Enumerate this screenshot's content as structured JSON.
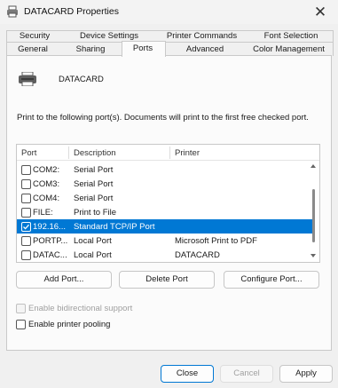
{
  "window": {
    "title": "DATACARD Properties",
    "close_glyph": "✕"
  },
  "tabs": {
    "row1": [
      "Security",
      "Device Settings",
      "Printer Commands",
      "Font Selection"
    ],
    "row2": [
      "General",
      "Sharing",
      "Ports",
      "Advanced",
      "Color Management"
    ],
    "active": "Ports"
  },
  "printer": {
    "name": "DATACARD",
    "icon": "printer-icon"
  },
  "instructions": "Print to the following port(s). Documents will print to the first free checked port.",
  "ports_table": {
    "columns": [
      "Port",
      "Description",
      "Printer"
    ],
    "rows": [
      {
        "port": "COM2:",
        "description": "Serial Port",
        "printer": "",
        "checked": false,
        "selected": false
      },
      {
        "port": "COM3:",
        "description": "Serial Port",
        "printer": "",
        "checked": false,
        "selected": false
      },
      {
        "port": "COM4:",
        "description": "Serial Port",
        "printer": "",
        "checked": false,
        "selected": false
      },
      {
        "port": "FILE:",
        "description": "Print to File",
        "printer": "",
        "checked": false,
        "selected": false
      },
      {
        "port": "192.16...",
        "description": "Standard TCP/IP Port",
        "printer": "",
        "checked": true,
        "selected": true
      },
      {
        "port": "PORTP...",
        "description": "Local Port",
        "printer": "Microsoft Print to PDF",
        "checked": false,
        "selected": false
      },
      {
        "port": "DATAC...",
        "description": "Local Port",
        "printer": "DATACARD",
        "checked": false,
        "selected": false
      }
    ]
  },
  "port_buttons": {
    "add": "Add Port...",
    "delete": "Delete Port",
    "configure": "Configure Port..."
  },
  "options": {
    "bidirectional": {
      "label": "Enable bidirectional support",
      "checked": false,
      "enabled": false
    },
    "pooling": {
      "label": "Enable printer pooling",
      "checked": false,
      "enabled": true
    }
  },
  "dialog_buttons": {
    "close": "Close",
    "cancel": "Cancel",
    "apply": "Apply"
  },
  "colors": {
    "accent": "#0078d4",
    "background": "#f0f0f0",
    "panel": "#fbfbfb"
  }
}
